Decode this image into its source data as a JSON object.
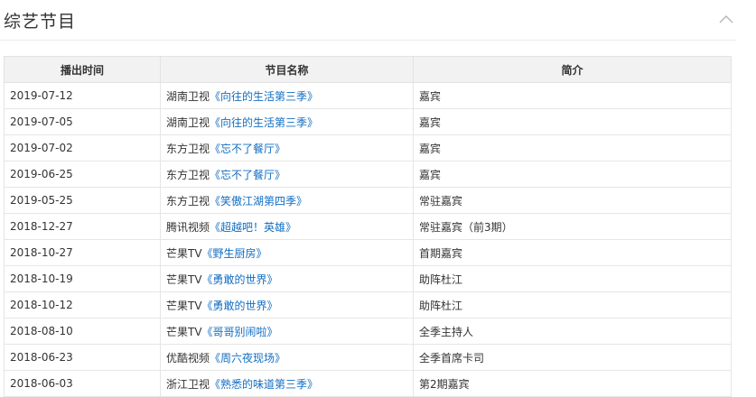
{
  "section": {
    "title": "综艺节目"
  },
  "table": {
    "headers": [
      "播出时间",
      "节目名称",
      "简介"
    ],
    "rows": [
      {
        "date": "2019-07-12",
        "channel": "湖南卫视",
        "show": "《向往的生活第三季》",
        "desc": "嘉宾"
      },
      {
        "date": "2019-07-05",
        "channel": "湖南卫视",
        "show": "《向往的生活第三季》",
        "desc": "嘉宾"
      },
      {
        "date": "2019-07-02",
        "channel": "东方卫视",
        "show": "《忘不了餐厅》",
        "desc": "嘉宾"
      },
      {
        "date": "2019-06-25",
        "channel": "东方卫视",
        "show": "《忘不了餐厅》",
        "desc": "嘉宾"
      },
      {
        "date": "2019-05-25",
        "channel": "东方卫视",
        "show": "《笑傲江湖第四季》",
        "desc": "常驻嘉宾"
      },
      {
        "date": "2018-12-27",
        "channel": "腾讯视频",
        "show": "《超越吧！英雄》",
        "desc": "常驻嘉宾（前3期）"
      },
      {
        "date": "2018-10-27",
        "channel": "芒果TV",
        "show": "《野生厨房》",
        "desc": "首期嘉宾"
      },
      {
        "date": "2018-10-19",
        "channel": "芒果TV",
        "show": "《勇敢的世界》",
        "desc": "助阵杜江"
      },
      {
        "date": "2018-10-12",
        "channel": "芒果TV",
        "show": "《勇敢的世界》",
        "desc": "助阵杜江"
      },
      {
        "date": "2018-08-10",
        "channel": "芒果TV",
        "show": "《哥哥别闹啦》",
        "desc": "全季主持人"
      },
      {
        "date": "2018-06-23",
        "channel": "优酷视频",
        "show": "《周六夜现场》",
        "desc": "全季首席卡司"
      },
      {
        "date": "2018-06-03",
        "channel": "浙江卫视",
        "show": "《熟悉的味道第三季》",
        "desc": "第2期嘉宾"
      }
    ]
  },
  "colors": {
    "link": "#136ec2",
    "header_bg": "#f2f2f2",
    "border": "#e6e6e6"
  },
  "icons": {
    "collapse": "chevron-up-icon"
  }
}
